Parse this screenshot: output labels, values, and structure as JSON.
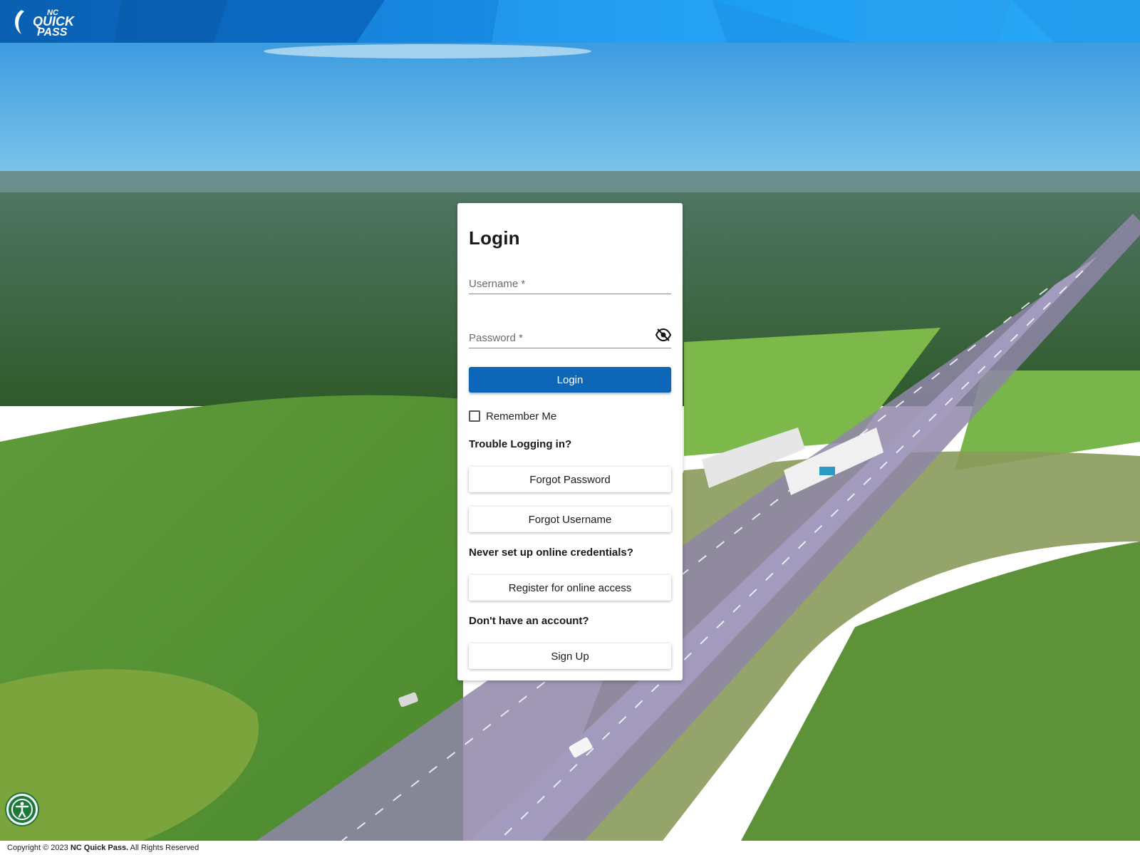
{
  "header": {
    "logo_alt": "NC QUICK PASS",
    "logo_lines": [
      "NC",
      "QUICK",
      "PASS"
    ]
  },
  "login": {
    "title": "Login",
    "username_placeholder": "Username *",
    "username_value": "",
    "password_placeholder": "Password *",
    "password_value": "",
    "login_button": "Login",
    "remember_me": "Remember Me",
    "remember_checked": false,
    "trouble_heading": "Trouble Logging in?",
    "forgot_password": "Forgot Password",
    "forgot_username": "Forgot Username",
    "never_setup_heading": "Never set up online credentials?",
    "register_button": "Register for online access",
    "no_account_heading": "Don't have an account?",
    "signup_button": "Sign Up"
  },
  "footer": {
    "prefix": "Copyright © 2023 ",
    "brand": "NC Quick Pass.",
    "suffix": " All Rights Reserved"
  },
  "icons": {
    "password_toggle": "eye-off-icon",
    "accessibility": "accessibility-icon"
  },
  "colors": {
    "primary": "#0e66b8",
    "header": "#0c72cf",
    "accessibility": "#1b7a3a"
  }
}
